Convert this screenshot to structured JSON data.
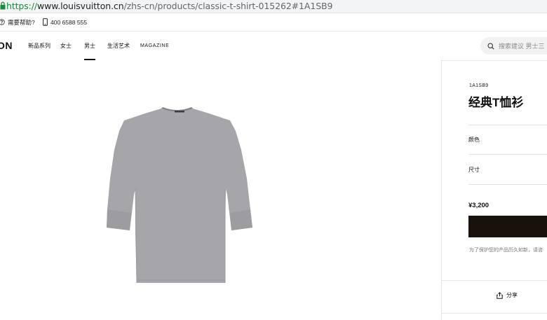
{
  "browser": {
    "url_scheme": "https://",
    "url_domain": "www.louisvuitton.cn",
    "url_path": "/zhs-cn/products/classic-t-shirt-015262#1A1SB9",
    "lock_icon": "lock-icon"
  },
  "utility_bar": {
    "help_label": "需要帮助?",
    "help_icon": "help-circle-icon",
    "phone": "400 6588 555",
    "phone_icon": "phone-icon"
  },
  "nav": {
    "logo": "ON",
    "items": [
      "新品系列",
      "女士",
      "男士",
      "生活艺术",
      "MAGAZINE"
    ],
    "active_item": "男士",
    "search_placeholder": "搜索建议 男士三",
    "search_icon": "search-icon"
  },
  "product": {
    "image_alt": "grey t-shirt",
    "sku": "1A1SB9",
    "title": "经典T恤衫",
    "color_label": "颜色",
    "size_label": "尺寸",
    "price": "¥3,200",
    "note": "为了保护您的产品历久如新，请咨",
    "share_label": "分享",
    "share_icon": "share-icon",
    "shirt_color": "#a6a6aa",
    "button_color": "#19110b"
  }
}
